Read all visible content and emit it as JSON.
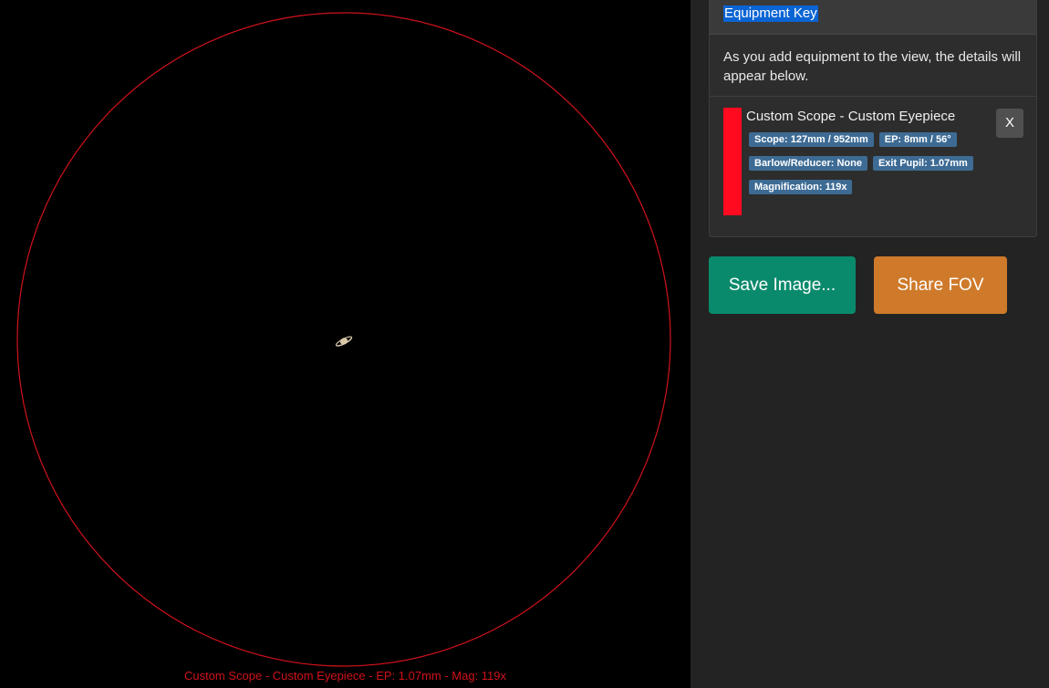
{
  "fov": {
    "caption": "Custom Scope - Custom Eyepiece - EP: 1.07mm - Mag: 119x",
    "ring_color": "#d0121b",
    "background": "#000000",
    "target_icon": "saturn-icon"
  },
  "equipment_key": {
    "title": "Equipment Key",
    "intro": "As you add equipment to the view, the details will appear below.",
    "items": [
      {
        "name": "Custom Scope - Custom Eyepiece",
        "color": "#ff0a1f",
        "tags": {
          "scope": "Scope: 127mm / 952mm",
          "ep": "EP: 8mm / 56°",
          "barlow": "Barlow/Reducer: None",
          "exit_pupil": "Exit Pupil: 1.07mm",
          "magnification": "Magnification: 119x"
        },
        "remove_label": "X"
      }
    ]
  },
  "actions": {
    "save_label": "Save Image...",
    "share_label": "Share FOV",
    "save_color": "#0a8a6c",
    "share_color": "#cf7a2a"
  }
}
